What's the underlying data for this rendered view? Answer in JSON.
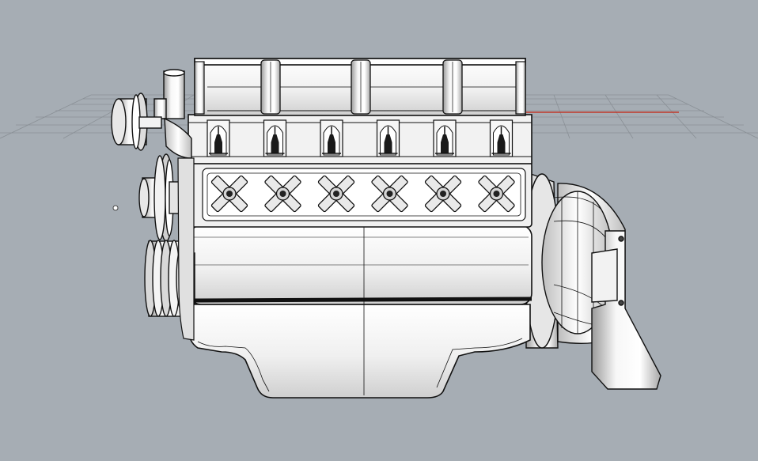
{
  "viewport": {
    "background": "#a6adb4",
    "grid_color": "#8a9096",
    "x_axis_color": "#c0392b",
    "model_fill": "#f4f4f4",
    "model_shade": "#cfcfcf",
    "model_edge": "#111111"
  },
  "model": {
    "cylinder_count": 6,
    "spark_plug_count": 6
  }
}
